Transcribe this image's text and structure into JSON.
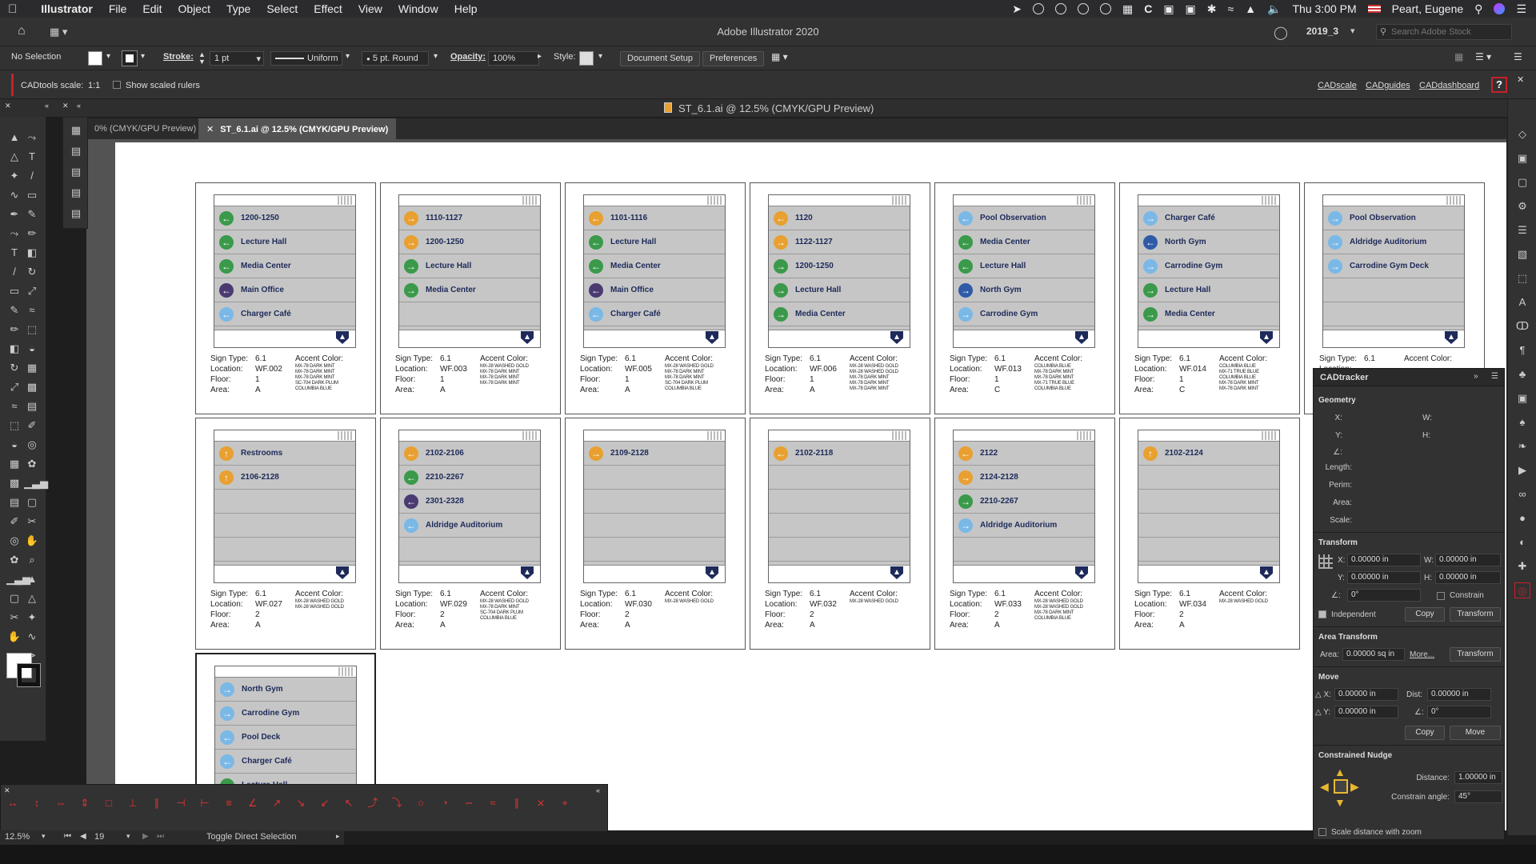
{
  "menubar": {
    "app": "Illustrator",
    "items": [
      "File",
      "Edit",
      "Object",
      "Type",
      "Select",
      "Effect",
      "View",
      "Window",
      "Help"
    ],
    "clock": "Thu 3:00 PM",
    "user": "Peart, Eugene"
  },
  "appbar": {
    "title": "Adobe Illustrator 2020",
    "workspace": "2019_3",
    "search_placeholder": "Search Adobe Stock"
  },
  "control": {
    "selection": "No Selection",
    "stroke_label": "Stroke:",
    "stroke_value": "1 pt",
    "profile": "Uniform",
    "brush": "5 pt. Round",
    "opacity_label": "Opacity:",
    "opacity_value": "100%",
    "style_label": "Style:",
    "doc_setup": "Document Setup",
    "preferences": "Preferences"
  },
  "cadbar": {
    "scale_label": "CADtools scale:",
    "scale_value": "1:1",
    "show_rulers": "Show scaled rulers",
    "links": [
      "CADscale",
      "CADguides",
      "CADdashboard"
    ],
    "help": "?"
  },
  "docwindow": {
    "title": "ST_6.1.ai @ 12.5% (CMYK/GPU Preview)",
    "tabs": [
      "0% (CMYK/GPU Preview)",
      "ST_6.1.ai @ 12.5% (CMYK/GPU Preview)"
    ]
  },
  "colors": {
    "green": "#3a9a4a",
    "orange": "#e8a030",
    "purple": "#4b3a72",
    "lightblue": "#7ab8e6",
    "blue": "#2f5aa8",
    "navy": "#1d2a5a"
  },
  "signs": [
    {
      "type": "6.1",
      "location": "WF.002",
      "floor": "1",
      "area": "A",
      "accents": [
        "MX-78 DARK MINT",
        "MX-78 DARK MINT",
        "MX-78 DARK MINT",
        "SC-704 DARK PLUM",
        "COLUMBIA BLUE"
      ],
      "rows": [
        {
          "arrow": "left",
          "color": "green",
          "text": "1200-1250"
        },
        {
          "arrow": "left",
          "color": "green",
          "text": "Lecture Hall"
        },
        {
          "arrow": "left",
          "color": "green",
          "text": "Media Center"
        },
        {
          "arrow": "left",
          "color": "purple",
          "text": "Main Office"
        },
        {
          "arrow": "left",
          "color": "lightblue",
          "text": "Charger Café"
        }
      ]
    },
    {
      "type": "6.1",
      "location": "WF.003",
      "floor": "1",
      "area": "A",
      "accents": [
        "MX-28 WASHED GOLD",
        "MX-78 DARK MINT",
        "MX-78 DARK MINT",
        "MX-78 DARK MINT"
      ],
      "rows": [
        {
          "arrow": "right",
          "color": "orange",
          "text": "1110-1127"
        },
        {
          "arrow": "right",
          "color": "orange",
          "text": "1200-1250"
        },
        {
          "arrow": "right",
          "color": "green",
          "text": "Lecture Hall"
        },
        {
          "arrow": "right",
          "color": "green",
          "text": "Media Center"
        }
      ]
    },
    {
      "type": "6.1",
      "location": "WF.005",
      "floor": "1",
      "area": "A",
      "accents": [
        "MX-28 WASHED GOLD",
        "MX-78 DARK MINT",
        "MX-78 DARK MINT",
        "SC-704 DARK PLUM",
        "COLUMBIA BLUE"
      ],
      "rows": [
        {
          "arrow": "left",
          "color": "orange",
          "text": "1101-1116"
        },
        {
          "arrow": "left",
          "color": "green",
          "text": "Lecture Hall"
        },
        {
          "arrow": "left",
          "color": "green",
          "text": "Media Center"
        },
        {
          "arrow": "left",
          "color": "purple",
          "text": "Main Office"
        },
        {
          "arrow": "left",
          "color": "lightblue",
          "text": "Charger Café"
        }
      ]
    },
    {
      "type": "6.1",
      "location": "WF.006",
      "floor": "1",
      "area": "A",
      "accents": [
        "MX-28 WASHED GOLD",
        "MX-28 WASHED GOLD",
        "MX-78 DARK MINT",
        "MX-78 DARK MINT",
        "MX-78 DARK MINT"
      ],
      "rows": [
        {
          "arrow": "left",
          "color": "orange",
          "text": "1120"
        },
        {
          "arrow": "right",
          "color": "orange",
          "text": "1122-1127"
        },
        {
          "arrow": "right",
          "color": "green",
          "text": "1200-1250"
        },
        {
          "arrow": "right",
          "color": "green",
          "text": "Lecture Hall"
        },
        {
          "arrow": "right",
          "color": "green",
          "text": "Media Center"
        }
      ]
    },
    {
      "type": "6.1",
      "location": "WF.013",
      "floor": "1",
      "area": "C",
      "accents": [
        "COLUMBIA BLUE",
        "MX-78 DARK MINT",
        "MX-78 DARK MINT",
        "MX-71 TRUE BLUE",
        "COLUMBIA BLUE"
      ],
      "rows": [
        {
          "arrow": "left",
          "color": "lightblue",
          "text": "Pool Observation"
        },
        {
          "arrow": "left",
          "color": "green",
          "text": "Media Center"
        },
        {
          "arrow": "left",
          "color": "green",
          "text": "Lecture Hall"
        },
        {
          "arrow": "right",
          "color": "blue",
          "text": "North Gym"
        },
        {
          "arrow": "right",
          "color": "lightblue",
          "text": "Carrodine Gym"
        }
      ]
    },
    {
      "type": "6.1",
      "location": "WF.014",
      "floor": "1",
      "area": "C",
      "accents": [
        "COLUMBIA BLUE",
        "MX-71 TRUE BLUE",
        "COLUMBIA BLUE",
        "MX-78 DARK MINT",
        "MX-78 DARK MINT"
      ],
      "rows": [
        {
          "arrow": "right",
          "color": "lightblue",
          "text": "Charger Café"
        },
        {
          "arrow": "left",
          "color": "blue",
          "text": "North Gym"
        },
        {
          "arrow": "right",
          "color": "lightblue",
          "text": "Carrodine Gym"
        },
        {
          "arrow": "right",
          "color": "green",
          "text": "Lecture Hall"
        },
        {
          "arrow": "right",
          "color": "green",
          "text": "Media Center"
        }
      ]
    },
    {
      "type": "6.1",
      "location": "",
      "floor": "",
      "area": "",
      "accents": [],
      "rows": [
        {
          "arrow": "right",
          "color": "lightblue",
          "text": "Pool Observation"
        },
        {
          "arrow": "right",
          "color": "lightblue",
          "text": "Aldridge Auditorium"
        },
        {
          "arrow": "right",
          "color": "lightblue",
          "text": "Carrodine Gym Deck"
        }
      ]
    },
    {
      "type": "6.1",
      "location": "WF.027",
      "floor": "2",
      "area": "A",
      "accents": [
        "MX-28 WASHED GOLD",
        "MX-28 WASHED GOLD"
      ],
      "rows": [
        {
          "arrow": "up",
          "color": "orange",
          "text": "Restrooms"
        },
        {
          "arrow": "up",
          "color": "orange",
          "text": "2106-2128"
        }
      ]
    },
    {
      "type": "6.1",
      "location": "WF.029",
      "floor": "2",
      "area": "A",
      "accents": [
        "MX-28 WASHED GOLD",
        "MX-78 DARK MINT",
        "SC-704 DARK PLUM",
        "COLUMBIA BLUE"
      ],
      "rows": [
        {
          "arrow": "left",
          "color": "orange",
          "text": "2102-2106"
        },
        {
          "arrow": "left",
          "color": "green",
          "text": "2210-2267"
        },
        {
          "arrow": "left",
          "color": "purple",
          "text": "2301-2328"
        },
        {
          "arrow": "left",
          "color": "lightblue",
          "text": "Aldridge Auditorium"
        }
      ]
    },
    {
      "type": "6.1",
      "location": "WF.030",
      "floor": "2",
      "area": "A",
      "accents": [
        "MX-28 WASHED GOLD"
      ],
      "rows": [
        {
          "arrow": "right",
          "color": "orange",
          "text": "2109-2128"
        }
      ]
    },
    {
      "type": "6.1",
      "location": "WF.032",
      "floor": "2",
      "area": "A",
      "accents": [
        "MX-28 WASHED GOLD"
      ],
      "rows": [
        {
          "arrow": "left",
          "color": "orange",
          "text": "2102-2118"
        }
      ]
    },
    {
      "type": "6.1",
      "location": "WF.033",
      "floor": "2",
      "area": "A",
      "accents": [
        "MX-28 WASHED GOLD",
        "MX-28 WASHED GOLD",
        "MX-78 DARK MINT",
        "COLUMBIA BLUE"
      ],
      "rows": [
        {
          "arrow": "left",
          "color": "orange",
          "text": "2122"
        },
        {
          "arrow": "right",
          "color": "orange",
          "text": "2124-2128"
        },
        {
          "arrow": "right",
          "color": "green",
          "text": "2210-2267"
        },
        {
          "arrow": "right",
          "color": "lightblue",
          "text": "Aldridge Auditorium"
        }
      ]
    },
    {
      "type": "6.1",
      "location": "WF.034",
      "floor": "2",
      "area": "A",
      "accents": [
        "MX-28 WASHED GOLD"
      ],
      "rows": [
        {
          "arrow": "up",
          "color": "orange",
          "text": "2102-2124"
        }
      ]
    },
    {
      "type": "",
      "location": "",
      "floor": "",
      "area": "",
      "accents": [],
      "rows": [
        {
          "arrow": "right",
          "color": "lightblue",
          "text": "North Gym"
        },
        {
          "arrow": "right",
          "color": "lightblue",
          "text": "Carrodine Gym"
        },
        {
          "arrow": "left",
          "color": "lightblue",
          "text": "Pool Deck"
        },
        {
          "arrow": "left",
          "color": "lightblue",
          "text": "Charger Café"
        },
        {
          "arrow": "left",
          "color": "green",
          "text": "Lecture Hall"
        }
      ]
    }
  ],
  "labels": {
    "sign_type": "Sign Type:",
    "location": "Location:",
    "floor": "Floor:",
    "area": "Area:",
    "accent": "Accent Color:"
  },
  "cadtracker": {
    "title": "CADtracker",
    "geometry": "Geometry",
    "geo_labels": [
      "X:",
      "Y:",
      "∠:",
      "Length:",
      "Perim:",
      "Area:",
      "Scale:"
    ],
    "geo_w": "W:",
    "geo_h": "H:",
    "transform": "Transform",
    "tx": "0.00000 in",
    "ty": "0.00000 in",
    "tw": "0.00000 in",
    "th": "0.00000 in",
    "tangle": "0°",
    "constrain": "Constrain",
    "independent": "Independent",
    "copy": "Copy",
    "transform_btn": "Transform",
    "area_transform": "Area Transform",
    "area_label": "Area:",
    "area_value": "0.00000 sq in",
    "more": "More...",
    "move": "Move",
    "mx": "0.00000 in",
    "my": "0.00000 in",
    "dist_label": "Dist:",
    "dist": "0.00000 in",
    "mangle": "0°",
    "move_btn": "Move",
    "nudge": "Constrained Nudge",
    "distance_label": "Distance:",
    "distance": "1.00000 in",
    "cangle_label": "Constrain angle:",
    "cangle": "45°",
    "scale_zoom": "Scale distance with zoom"
  },
  "status": {
    "zoom": "12.5%",
    "artboard": "19",
    "tool": "Toggle Direct Selection"
  }
}
